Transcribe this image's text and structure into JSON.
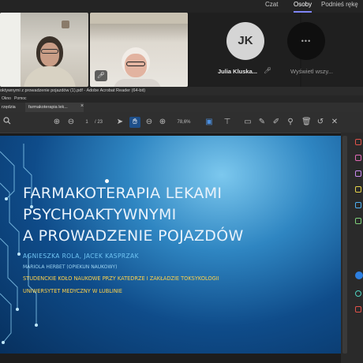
{
  "teams": {
    "tabs": [
      "Czat",
      "Osoby",
      "Podnieś rękę"
    ],
    "active_tab": "Osoby",
    "participant_initials": "JK",
    "participant_name": "Julia Kluska...",
    "view_all_label": "Wyświetl wszy...",
    "more_glyph": "•••"
  },
  "reader": {
    "window_title": "oktywnymi z prowadzenie pojazdów (1).pdf - Adobe Acrobat Reader (64-bit)",
    "menu": [
      "Okno",
      "Pomoc"
    ],
    "left_tab": "rzędzia",
    "doc_tab": "farmakoterapia lek...",
    "page_current": "1",
    "page_total": "/ 23",
    "zoom": "78,6%"
  },
  "slide": {
    "title_lines": [
      "Farmakoterapia lekami",
      "psychoaktywnymi",
      "a prowadzenie pojazdów"
    ],
    "authors": "Agnieszka Rola, Jacek Kasprzak",
    "supervisor": "Mariola Herbet (opiekun naukowy)",
    "circle": "Studenckie Koło Naukowe przy Katedrze i Zakładzie Toksykologii",
    "university": "Uniwersytet Medyczny w Lublinie"
  },
  "colors": {
    "accent": "#7f85f5",
    "slide_title": "#e8f2fb",
    "slide_authors": "#6fc3f2",
    "slide_supervisor": "#9fd6f3",
    "slide_highlight": "#ffd24a"
  }
}
